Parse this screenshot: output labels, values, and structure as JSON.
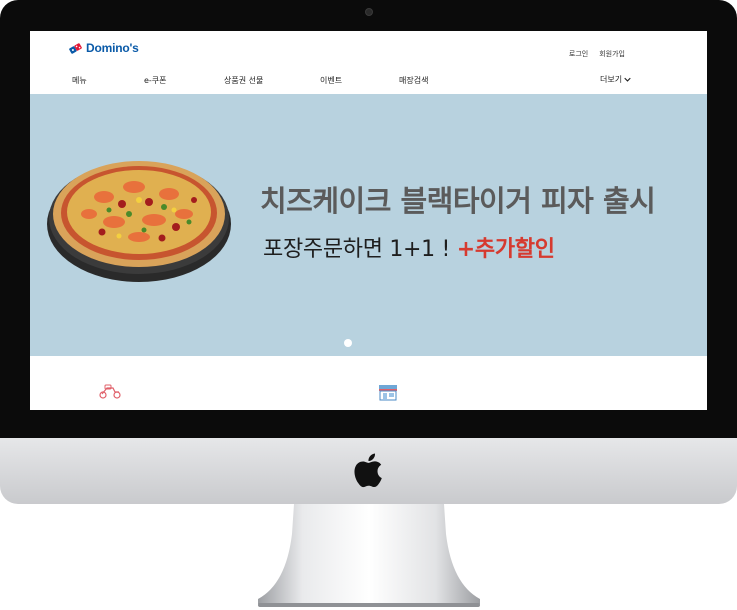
{
  "brand": {
    "name": "Domino's",
    "primary": "#0a5aa8",
    "accent": "#d63a2f"
  },
  "utility_nav": {
    "login": "로그인",
    "signup": "회원가입"
  },
  "main_nav": {
    "items": [
      {
        "label": "메뉴"
      },
      {
        "label": "e-쿠폰"
      },
      {
        "label": "상품권 선물"
      },
      {
        "label": "이벤트"
      },
      {
        "label": "매장검색"
      }
    ],
    "more_label": "더보기"
  },
  "banner": {
    "background": "#b8d2df",
    "title": "치즈케이크 블랙타이거 피자 출시",
    "subtitle_main": "포장주문하면 1+1 !",
    "subtitle_accent": "+추가할인"
  },
  "icons": [
    "domino-logo-icon",
    "chevron-down-icon",
    "pizza-image",
    "delivery-scooter-icon",
    "store-icon",
    "apple-logo-icon"
  ]
}
